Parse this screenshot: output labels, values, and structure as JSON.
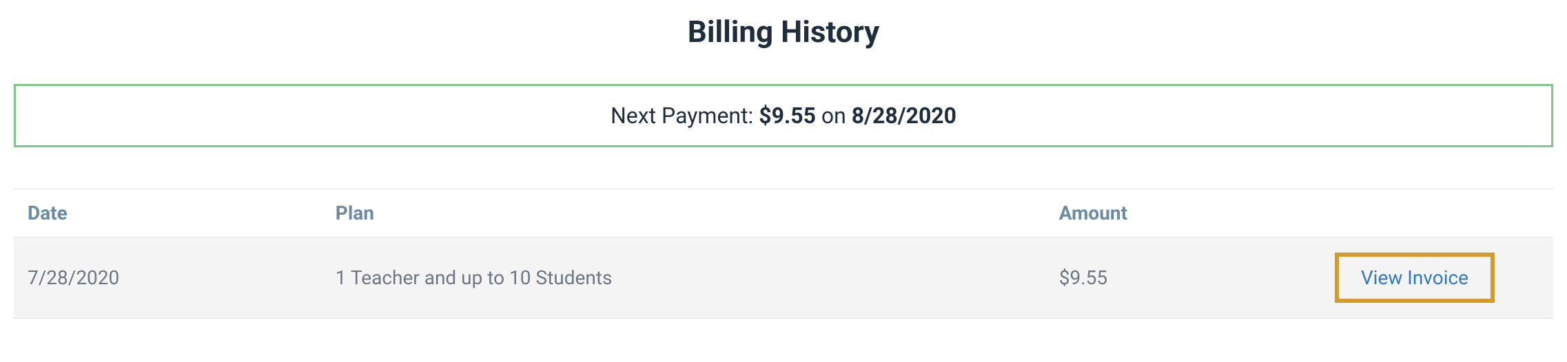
{
  "title": "Billing History",
  "nextPayment": {
    "label": "Next Payment: ",
    "amount": "$9.55",
    "onText": " on ",
    "date": "8/28/2020"
  },
  "table": {
    "headers": {
      "date": "Date",
      "plan": "Plan",
      "amount": "Amount",
      "action": ""
    },
    "rows": [
      {
        "date": "7/28/2020",
        "plan": "1 Teacher and up to 10 Students",
        "amount": "$9.55",
        "actionLabel": "View Invoice"
      }
    ]
  }
}
